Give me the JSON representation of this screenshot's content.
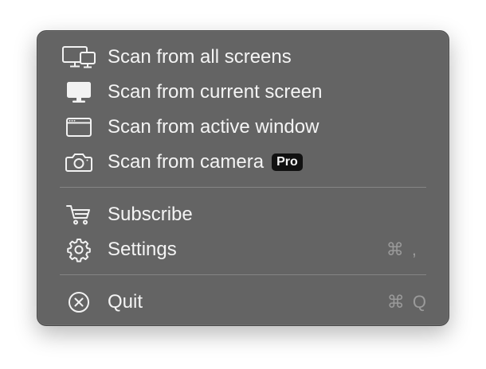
{
  "menu": {
    "items": [
      {
        "label": "Scan from all screens",
        "icon": "multiple-screens-icon"
      },
      {
        "label": "Scan from current screen",
        "icon": "monitor-icon"
      },
      {
        "label": "Scan from active window",
        "icon": "window-icon"
      },
      {
        "label": "Scan from camera",
        "icon": "camera-icon",
        "badge": "Pro"
      },
      {
        "label": "Subscribe",
        "icon": "cart-icon"
      },
      {
        "label": "Settings",
        "icon": "gear-icon",
        "shortcut": "⌘ ,"
      },
      {
        "label": "Quit",
        "icon": "close-circle-icon",
        "shortcut": "⌘ Q"
      }
    ]
  },
  "colors": {
    "menu_background": "#646464",
    "text": "#f4f4f4",
    "shortcut_text": "#9a9a9a",
    "badge_background": "#111111"
  }
}
